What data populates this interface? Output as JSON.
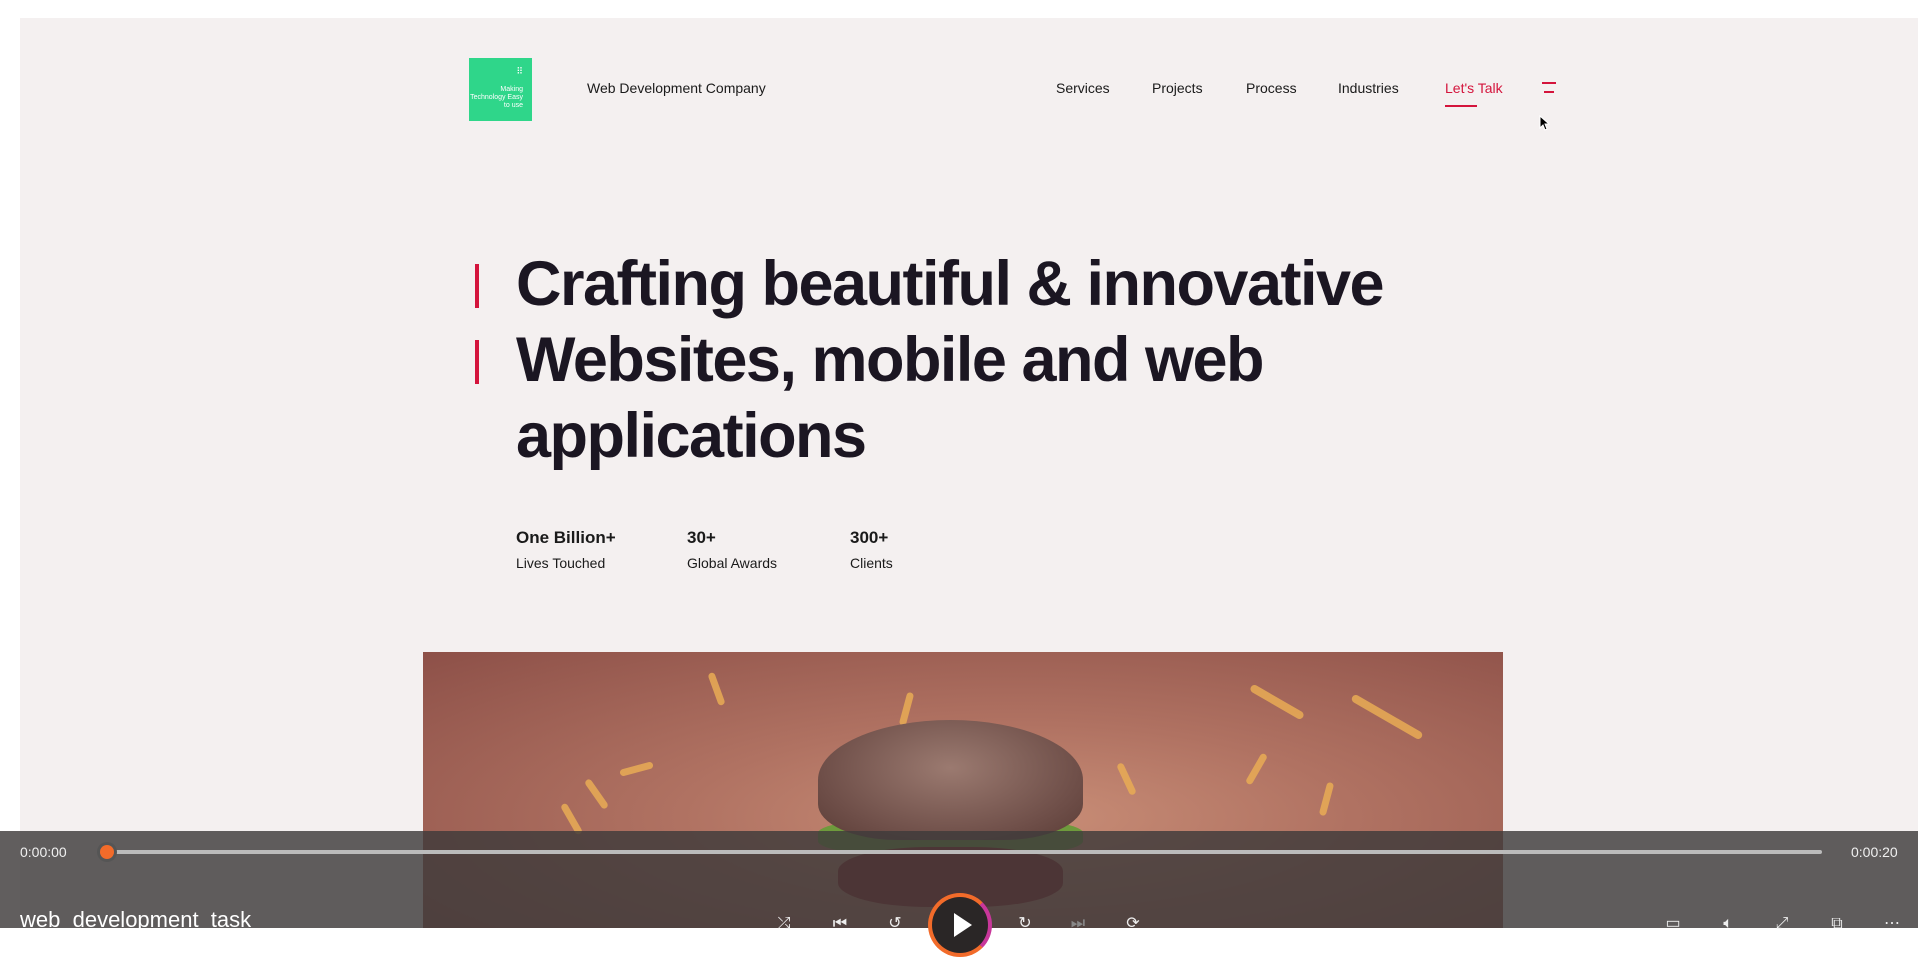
{
  "header": {
    "logo_text": "Making Technology Easy to use",
    "company_name": "Web Development Company",
    "nav": [
      "Services",
      "Projects",
      "Process",
      "Industries",
      "Let's Talk"
    ]
  },
  "hero": {
    "lines": [
      "Crafting beautiful & innovative",
      "Websites, mobile and web",
      "applications"
    ]
  },
  "stats": [
    {
      "value": "One Billion+",
      "label": "Lives Touched"
    },
    {
      "value": "30+",
      "label": "Global Awards"
    },
    {
      "value": "300+",
      "label": "Clients"
    }
  ],
  "player": {
    "current_time": "0:00:00",
    "duration": "0:00:20",
    "title": "web_development_task",
    "progress": 0
  },
  "colors": {
    "accent": "#d4143c",
    "logo_green": "#2fd68a",
    "player_accent": "#f26b2a"
  },
  "icons": [
    "menu-icon",
    "cursor-icon",
    "shuffle-icon",
    "previous-icon",
    "rewind-10-icon",
    "play-icon",
    "forward-30-icon",
    "next-icon",
    "repeat-icon",
    "captions-icon",
    "volume-icon",
    "fullscreen-icon",
    "mini-player-icon",
    "more-icon"
  ]
}
